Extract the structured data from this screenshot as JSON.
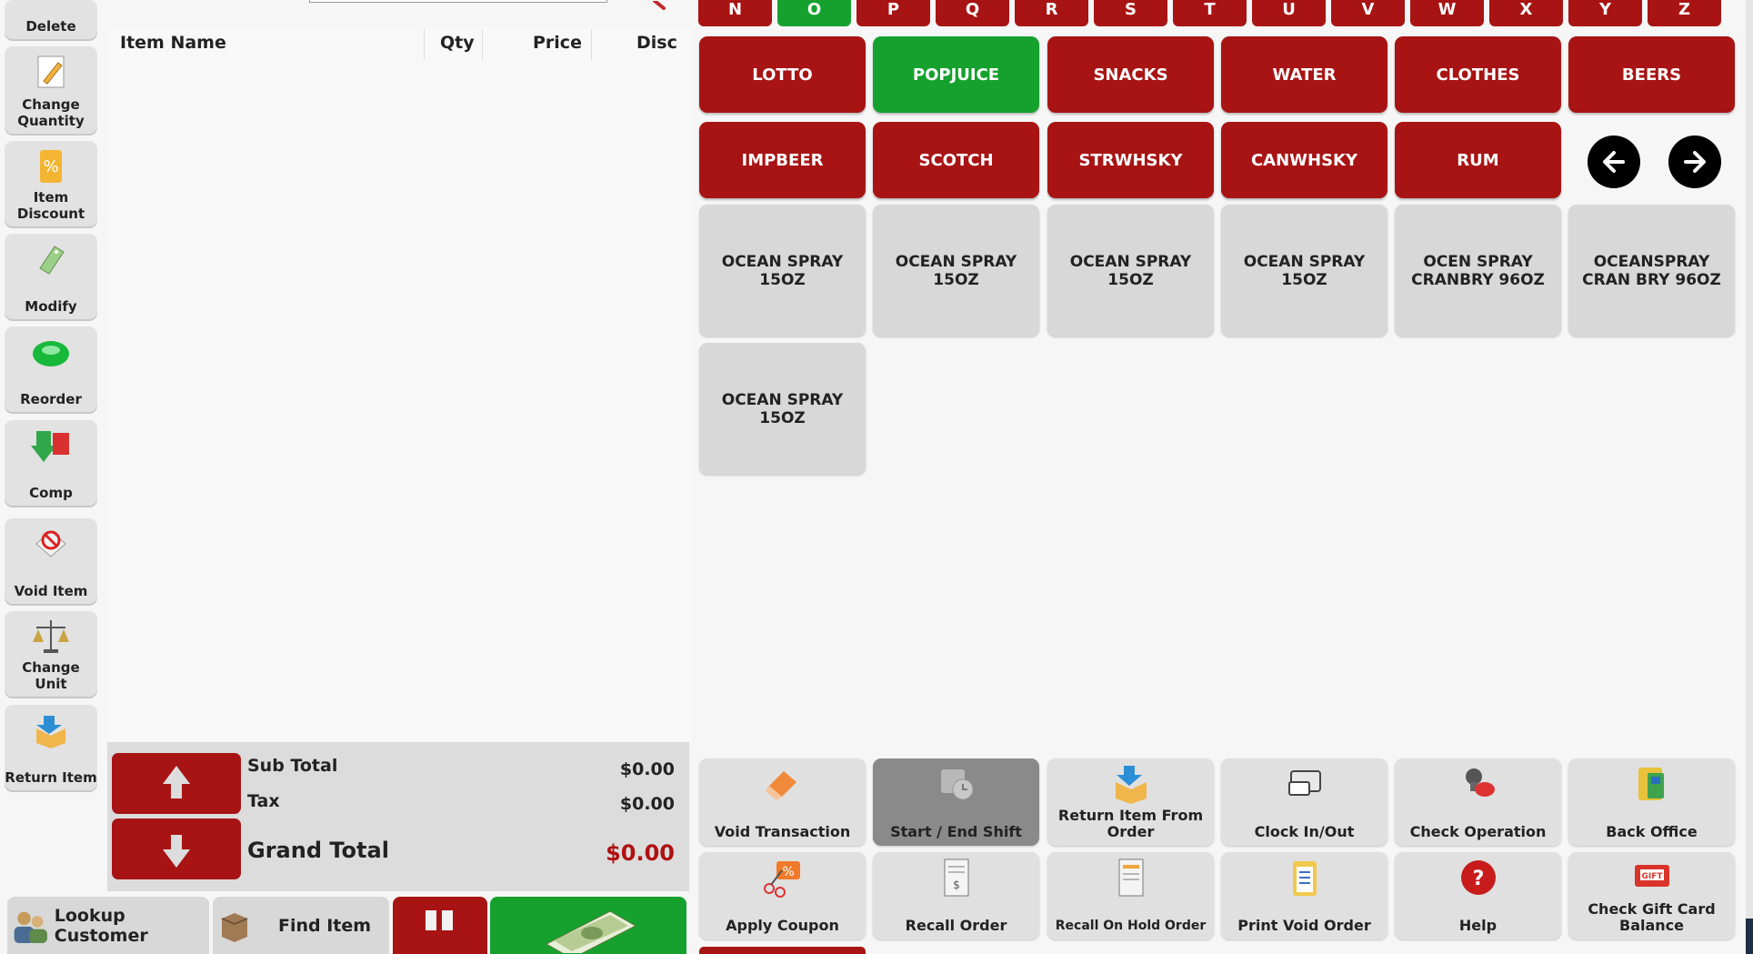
{
  "sidebar": {
    "items": [
      {
        "label": "Delete",
        "icon": "delete-icon"
      },
      {
        "label": "Change Quantity",
        "icon": "notepad-pencil-icon"
      },
      {
        "label": "Item Discount",
        "icon": "percent-tag-icon"
      },
      {
        "label": "Modify",
        "icon": "tag-pencil-icon"
      },
      {
        "label": "Reorder",
        "icon": "green-orb-icon"
      },
      {
        "label": "Comp",
        "icon": "down-arrow-free-icon"
      },
      {
        "label": "Void Item",
        "icon": "void-tag-icon"
      },
      {
        "label": "Change Unit",
        "icon": "scale-icon"
      },
      {
        "label": "Return Item",
        "icon": "return-box-icon"
      }
    ]
  },
  "order": {
    "columns": [
      "Item Name",
      "Qty",
      "Price",
      "Disc"
    ],
    "totals": {
      "subtotal_label": "Sub Total",
      "subtotal_value": "$0.00",
      "tax_label": "Tax",
      "tax_value": "$0.00",
      "grand_label": "Grand Total",
      "grand_value": "$0.00"
    }
  },
  "bottom": {
    "lookup_label": "Lookup Customer",
    "find_label": "Find Item"
  },
  "letters": [
    "N",
    "O",
    "P",
    "Q",
    "R",
    "S",
    "T",
    "U",
    "V",
    "W",
    "X",
    "Y",
    "Z"
  ],
  "active_letter": "O",
  "categories": {
    "row1": [
      "LOTTO",
      "POPJUICE",
      "SNACKS",
      "WATER",
      "CLOTHES",
      "BEERS"
    ],
    "row2": [
      "IMPBEER",
      "SCOTCH",
      "STRWHSKY",
      "CANWHSKY",
      "RUM"
    ],
    "active": "POPJUICE"
  },
  "products": [
    "OCEAN SPRAY 15OZ",
    "OCEAN SPRAY 15OZ",
    "OCEAN SPRAY 15OZ",
    "OCEAN SPRAY 15OZ",
    "OCEN SPRAY CRANBRY 96OZ",
    "OCEANSPRAY CRAN BRY 96OZ",
    "OCEAN SPRAY 15OZ"
  ],
  "functions": {
    "row1": [
      {
        "label": "Void Transaction",
        "icon": "eraser-icon"
      },
      {
        "label": "Start / End Shift",
        "icon": "clock-icon"
      },
      {
        "label": "Return Item From Order",
        "icon": "return-box-icon"
      },
      {
        "label": "Clock In/Out",
        "icon": "card-swipe-icon"
      },
      {
        "label": "Check Operation",
        "icon": "stamp-icon"
      },
      {
        "label": "Back Office",
        "icon": "folder-icon"
      }
    ],
    "row2": [
      {
        "label": "Apply Coupon",
        "icon": "scissors-coupon-icon"
      },
      {
        "label": "Recall Order",
        "icon": "receipt-icon"
      },
      {
        "label": "Recall On Hold Order",
        "icon": "receipt-hold-icon"
      },
      {
        "label": "Print Void Order",
        "icon": "clipboard-icon"
      },
      {
        "label": "Help",
        "icon": "help-icon"
      },
      {
        "label": "Check Gift Card Balance",
        "icon": "gift-card-icon"
      }
    ]
  },
  "colors": {
    "accent_red": "#a81414",
    "accent_green": "#16a12e",
    "grand_total_red": "#b01010"
  }
}
